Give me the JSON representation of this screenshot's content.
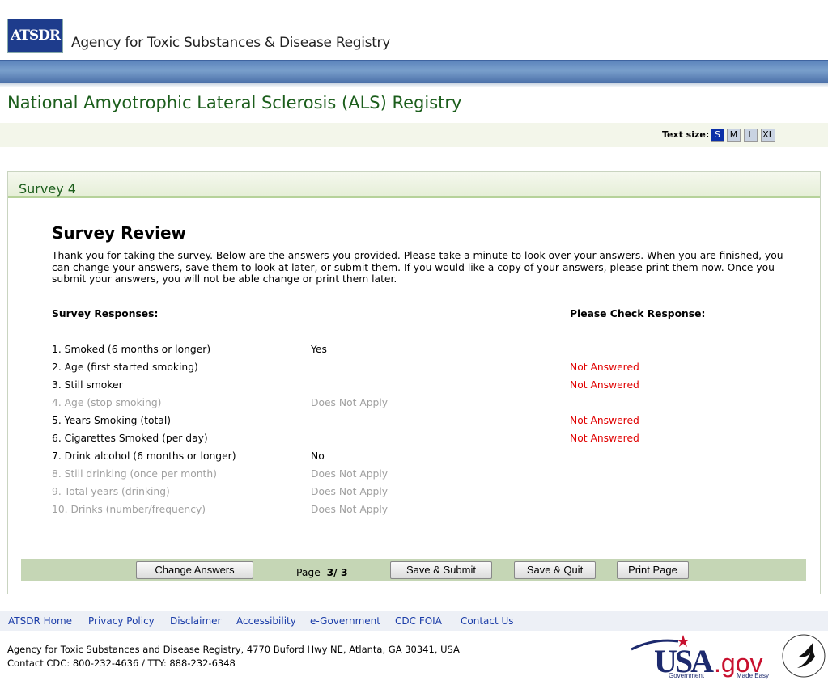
{
  "header": {
    "logo_text": "ATSDR",
    "agency": "Agency for Toxic Substances & Disease Registry",
    "title": "National Amyotrophic Lateral Sclerosis (ALS) Registry"
  },
  "text_size": {
    "label": "Text size:",
    "options": [
      "S",
      "M",
      "L",
      "XL"
    ],
    "selected": "S"
  },
  "panel": {
    "title": "Survey 4",
    "heading": "Survey Review",
    "intro": "Thank you for taking the survey. Below are the answers you provided. Please take a minute to look over your answers. When you are finished, you can change your answers, save them to look at later, or submit them. If you would like a copy of your answers, please print them now. Once you submit your answers, you will not be able change or print them later.",
    "col_responses": "Survey Responses:",
    "col_check": "Please Check Response:",
    "rows": [
      {
        "q": "1. Smoked (6 months or longer)",
        "a": "Yes",
        "check": "",
        "disabled": false
      },
      {
        "q": "2. Age (first started smoking)",
        "a": "",
        "check": "Not Answered",
        "disabled": false
      },
      {
        "q": "3. Still smoker",
        "a": "",
        "check": "Not Answered",
        "disabled": false
      },
      {
        "q": "4. Age (stop smoking)",
        "a": "Does Not Apply",
        "check": "",
        "disabled": true
      },
      {
        "q": "5. Years Smoking (total)",
        "a": "",
        "check": "Not Answered",
        "disabled": false
      },
      {
        "q": "6. Cigarettes Smoked (per day)",
        "a": "",
        "check": "Not Answered",
        "disabled": false
      },
      {
        "q": "7. Drink alcohol (6 months or longer)",
        "a": "No",
        "check": "",
        "disabled": false
      },
      {
        "q": "8. Still drinking (once per month)",
        "a": "Does Not Apply",
        "check": "",
        "disabled": true
      },
      {
        "q": "9. Total years (drinking)",
        "a": "Does Not Apply",
        "check": "",
        "disabled": true
      },
      {
        "q": "10. Drinks (number/frequency)",
        "a": "Does Not Apply",
        "check": "",
        "disabled": true
      }
    ]
  },
  "actions": {
    "change": "Change Answers",
    "page_label": "Page",
    "page_value": "3/ 3",
    "submit": "Save & Submit",
    "quit": "Save & Quit",
    "print": "Print Page"
  },
  "footer": {
    "links": [
      "ATSDR Home",
      "Privacy Policy",
      "Disclaimer",
      "Accessibility",
      "e-Government",
      "CDC FOIA",
      "Contact Us"
    ],
    "address": "Agency for Toxic Substances and Disease Registry, 4770 Buford Hwy NE, Atlanta, GA 30341, USA",
    "contact": "Contact CDC: 800-232-4636 / TTY: 888-232-6348",
    "usagov_logo": "USA.gov Government Made Easy"
  },
  "colors": {
    "title_green": "#1c5e1c",
    "not_answered": "#e00000",
    "accent_blue": "#0a2fa8"
  }
}
